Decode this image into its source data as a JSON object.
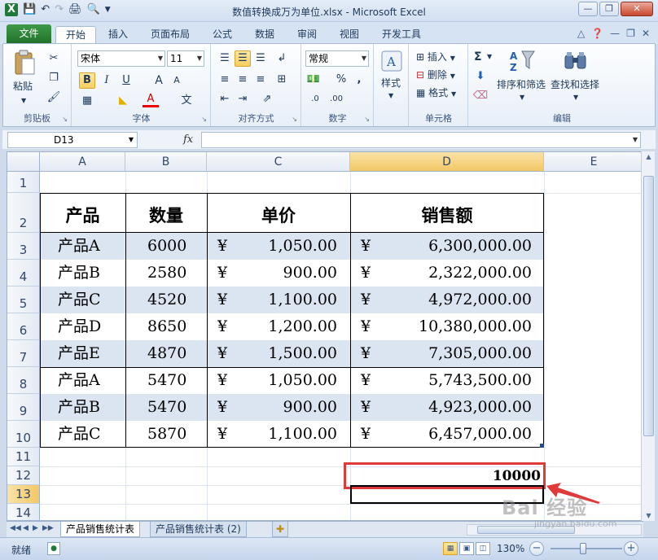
{
  "window": {
    "title": "数值转换成万为单位.xlsx - Microsoft Excel"
  },
  "ribbon_tabs": [
    {
      "label": "文件"
    },
    {
      "label": "开始"
    },
    {
      "label": "插入"
    },
    {
      "label": "页面布局"
    },
    {
      "label": "公式"
    },
    {
      "label": "数据"
    },
    {
      "label": "审阅"
    },
    {
      "label": "视图"
    },
    {
      "label": "开发工具"
    }
  ],
  "clipboard": {
    "paste": "粘贴",
    "group": "剪贴板"
  },
  "font": {
    "name": "宋体",
    "size": "11",
    "bold": "B",
    "italic": "I",
    "underline": "U",
    "grow": "A",
    "shrink": "A",
    "color": "A",
    "wen": "文",
    "group": "字体"
  },
  "alignment": {
    "group": "对齐方式"
  },
  "number": {
    "format": "常规",
    "percent": "%",
    "comma": ",",
    "inc": ".0",
    "dec": ".00",
    "group": "数字"
  },
  "styles": {
    "label": "样式"
  },
  "cells": {
    "insert": "插入",
    "delete": "删除",
    "format": "格式",
    "group": "单元格"
  },
  "editing": {
    "sum": "Σ",
    "sort": "排序和筛选",
    "find": "查找和选择",
    "group": "编辑"
  },
  "formula_bar": {
    "name_box": "D13",
    "fx": "fx",
    "formula": ""
  },
  "columns": [
    "A",
    "B",
    "C",
    "D",
    "E"
  ],
  "rows": [
    "1",
    "2",
    "3",
    "4",
    "5",
    "6",
    "7",
    "8",
    "9",
    "10",
    "11",
    "12",
    "13",
    "14"
  ],
  "table": {
    "headers": [
      "产品",
      "数量",
      "单价",
      "销售额"
    ],
    "currency": "¥",
    "rows": [
      {
        "product": "产品A",
        "qty": "6000",
        "price": "1,050.00",
        "sales": "6,300,000.00"
      },
      {
        "product": "产品B",
        "qty": "2580",
        "price": "900.00",
        "sales": "2,322,000.00"
      },
      {
        "product": "产品C",
        "qty": "4520",
        "price": "1,100.00",
        "sales": "4,972,000.00"
      },
      {
        "product": "产品D",
        "qty": "8650",
        "price": "1,200.00",
        "sales": "10,380,000.00"
      },
      {
        "product": "产品E",
        "qty": "4870",
        "price": "1,500.00",
        "sales": "7,305,000.00"
      },
      {
        "product": "产品A",
        "qty": "5470",
        "price": "1,050.00",
        "sales": "5,743,500.00"
      },
      {
        "product": "产品B",
        "qty": "5470",
        "price": "900.00",
        "sales": "4,923,000.00"
      },
      {
        "product": "产品C",
        "qty": "5870",
        "price": "1,100.00",
        "sales": "6,457,000.00"
      }
    ]
  },
  "d12_value": "10000",
  "sheet_tabs": [
    {
      "label": "产品销售统计表"
    },
    {
      "label": "产品销售统计表 (2)"
    }
  ],
  "status": {
    "ready": "就绪",
    "zoom": "130%"
  },
  "watermark": {
    "text": "Bai 经验",
    "sub": "jingyan.baidu.com"
  },
  "colors": {
    "accent_green": "#20702a",
    "highlight_red": "#e0393a",
    "band": "#dbe5f1"
  }
}
